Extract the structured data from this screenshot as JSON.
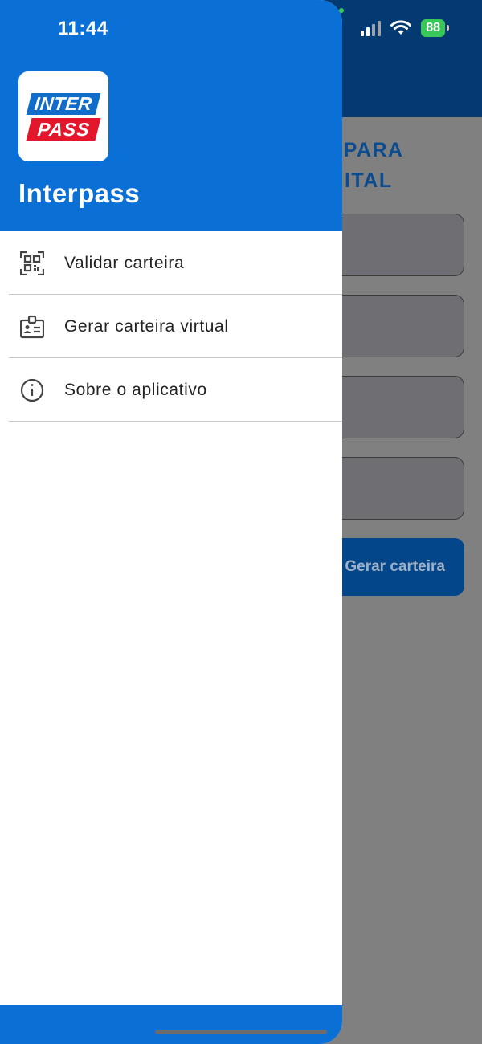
{
  "status_bar": {
    "time": "11:44",
    "battery": "88"
  },
  "background": {
    "title_line1": "XO PARA",
    "title_line2": "DIGITAL",
    "button_label": "Gerar carteira"
  },
  "drawer": {
    "logo": {
      "top_text": "INTER",
      "bottom_text": "PASS"
    },
    "title": "Interpass",
    "items": [
      {
        "label": "Validar carteira",
        "icon": "qr-code-icon"
      },
      {
        "label": "Gerar carteira virtual",
        "icon": "id-badge-icon"
      },
      {
        "label": "Sobre o aplicativo",
        "icon": "info-icon"
      }
    ]
  },
  "colors": {
    "primary": "#0a70d6",
    "background_header": "#043a72",
    "logo_blue": "#0f6dc9",
    "logo_red": "#e3172b",
    "battery_green": "#38c759"
  }
}
